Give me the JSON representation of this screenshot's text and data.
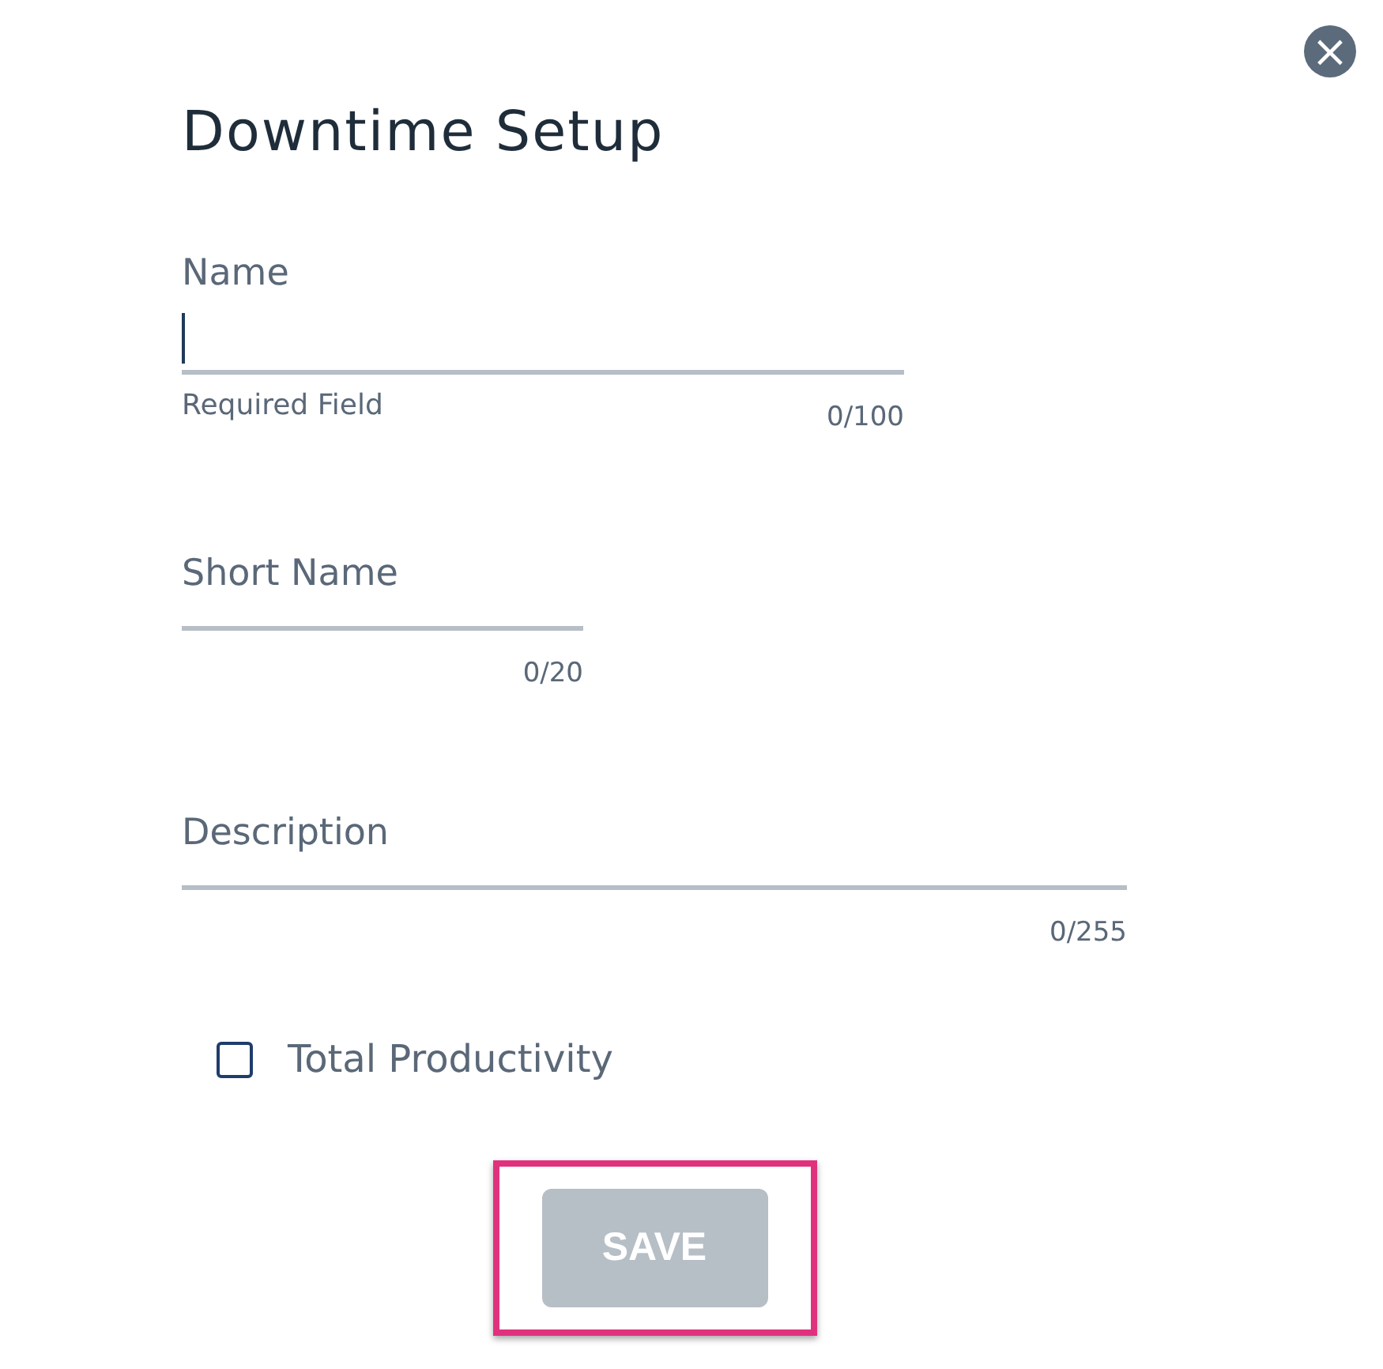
{
  "dialog": {
    "title": "Downtime Setup",
    "close_label": "×"
  },
  "fields": [
    {
      "label": "Name",
      "focused": true,
      "helper": "Required Field",
      "counter": "0/100"
    },
    {
      "label": "Short Name",
      "focused": false,
      "counter": "0/20"
    },
    {
      "label": "Description",
      "focused": false,
      "counter": "0/255"
    }
  ],
  "checkbox": {
    "label": "Total Productivity",
    "checked": false
  },
  "save_button": {
    "label": "SAVE",
    "disabled": true,
    "highlighted": true
  }
}
